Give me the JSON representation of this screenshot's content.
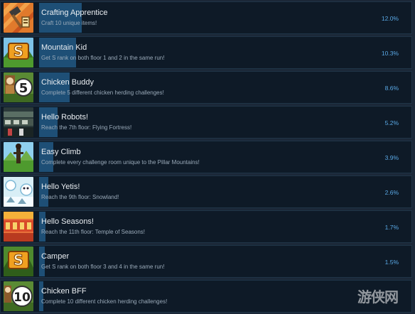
{
  "achievements": [
    {
      "title": "Crafting Apprentice",
      "desc": "Craft 10 unique items!",
      "percent": "12.0%",
      "percent_value": 12.0,
      "icon": "crafting-hammer-icon"
    },
    {
      "title": "Mountain Kid",
      "desc": "Get S rank on both floor 1 and 2 in the same run!",
      "percent": "10.3%",
      "percent_value": 10.3,
      "icon": "s-rank-mountain-icon"
    },
    {
      "title": "Chicken Buddy",
      "desc": "Complete 5 different chicken herding challenges!",
      "percent": "8.6%",
      "percent_value": 8.6,
      "icon": "chicken-5-icon"
    },
    {
      "title": "Hello Robots!",
      "desc": "Reach the 7th floor: Flying Fortress!",
      "percent": "5.2%",
      "percent_value": 5.2,
      "icon": "flying-fortress-icon"
    },
    {
      "title": "Easy Climb",
      "desc": "Complete every challenge room unique to the Pillar Mountains!",
      "percent": "3.9%",
      "percent_value": 3.9,
      "icon": "pillar-mountains-icon"
    },
    {
      "title": "Hello Yetis!",
      "desc": "Reach the 9th floor: Snowland!",
      "percent": "2.6%",
      "percent_value": 2.6,
      "icon": "snowland-icon"
    },
    {
      "title": "Hello Seasons!",
      "desc": "Reach the 11th floor: Temple of Seasons!",
      "percent": "1.7%",
      "percent_value": 1.7,
      "icon": "temple-of-seasons-icon"
    },
    {
      "title": "Camper",
      "desc": "Get S rank on both floor 3 and 4 in the same run!",
      "percent": "1.5%",
      "percent_value": 1.5,
      "icon": "s-rank-camper-icon"
    },
    {
      "title": "Chicken BFF",
      "desc": "Complete 10 different chicken herding challenges!",
      "percent": "",
      "percent_value": 1.2,
      "icon": "chicken-10-icon"
    }
  ],
  "icon_badges": {
    "mountain_kid": "S",
    "chicken_buddy": "5",
    "camper": "S",
    "chicken_bff": "10"
  },
  "watermark": "游侠网",
  "colors": {
    "background": "#1b2838",
    "row": "#0e1a27",
    "progress_bar": "#1e4f76",
    "percent_text": "#5aa9e6"
  }
}
